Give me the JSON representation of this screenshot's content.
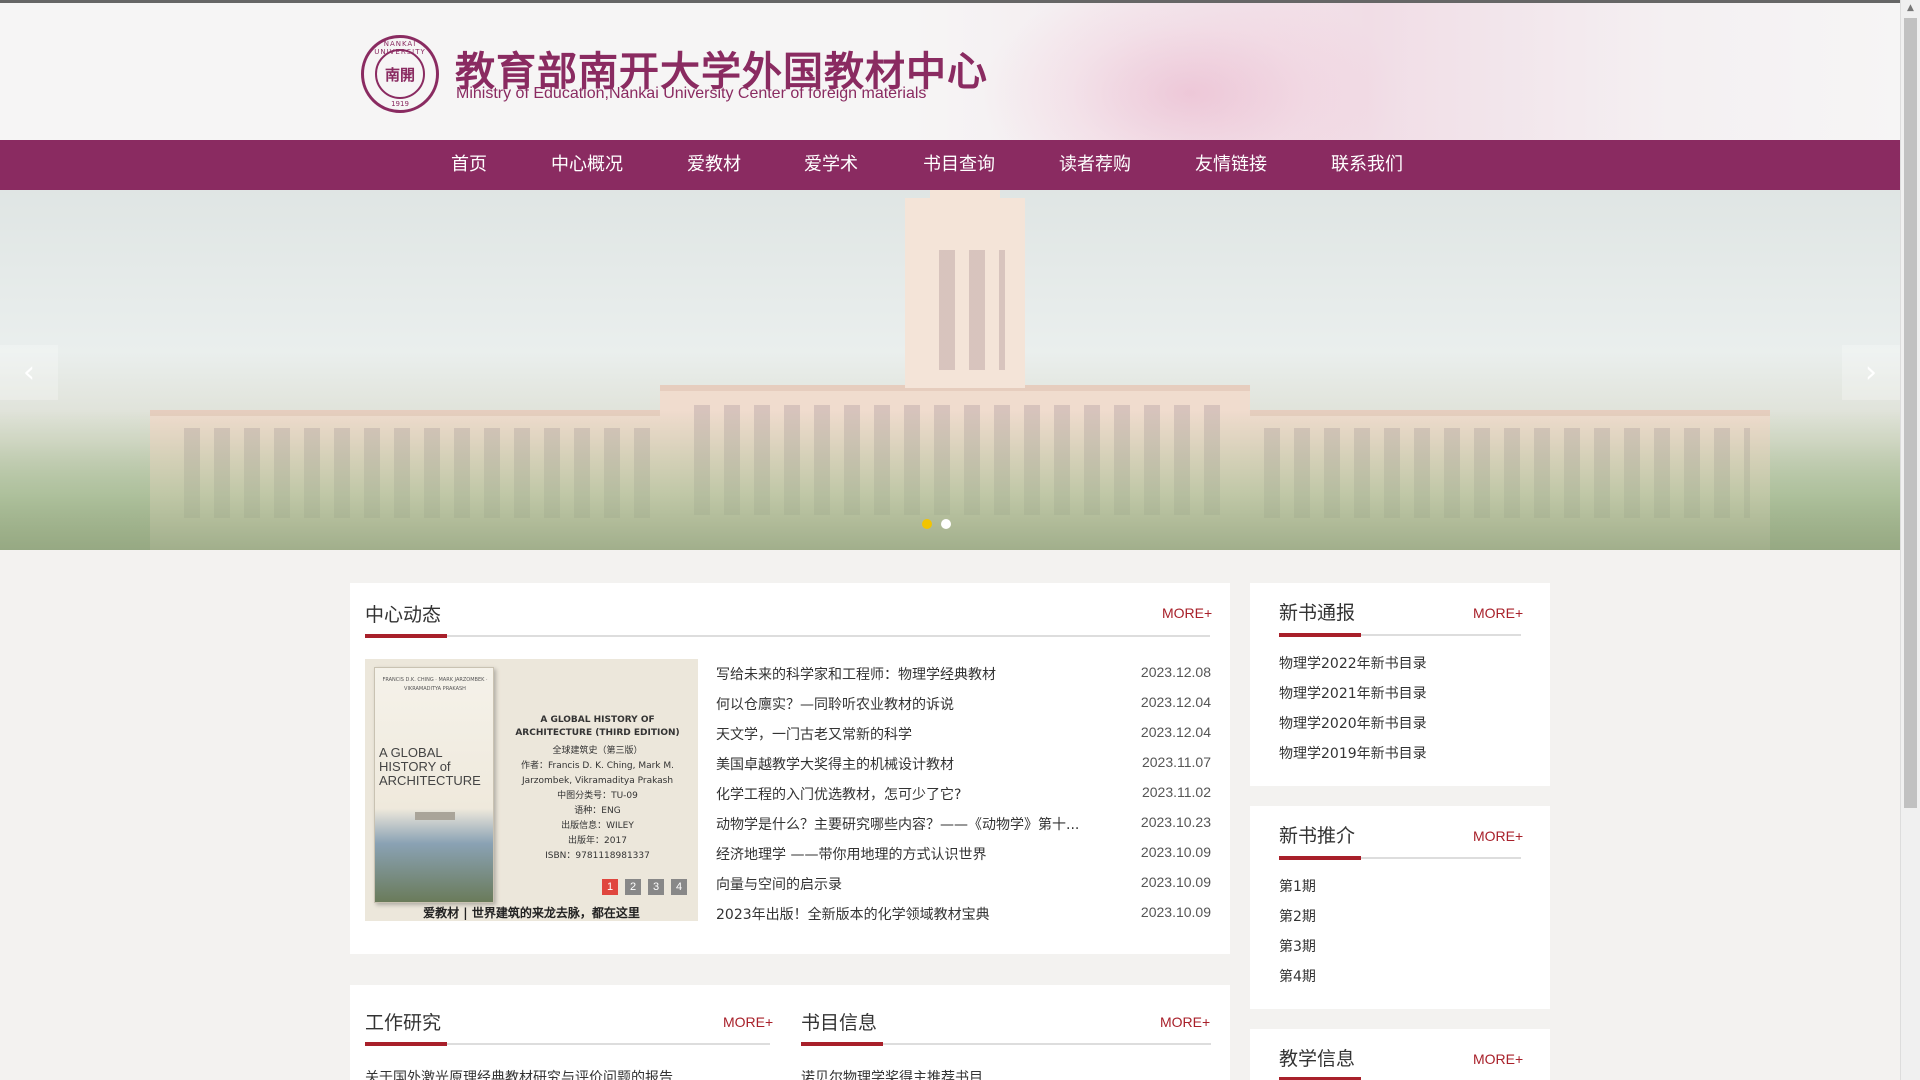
{
  "header": {
    "seal_center": "南開",
    "seal_top": "NANKAI UNIVERSITY",
    "seal_year": "1919",
    "title_cn": "教育部南开大学外国教材中心",
    "title_en": "Ministry of Education,Nankai University Center of foreign materials"
  },
  "nav": {
    "items": [
      {
        "label": "首页"
      },
      {
        "label": "中心概况"
      },
      {
        "label": "爱教材"
      },
      {
        "label": "爱学术"
      },
      {
        "label": "书目查询"
      },
      {
        "label": "读者荐购"
      },
      {
        "label": "友情链接"
      },
      {
        "label": "联系我们"
      }
    ]
  },
  "banner": {
    "prev_icon": "chevron-left-icon",
    "next_icon": "chevron-right-icon",
    "dots": [
      {
        "active": true,
        "color": "#f2c400"
      },
      {
        "active": false,
        "color": "#ffffff"
      }
    ]
  },
  "center_news": {
    "title": "中心动态",
    "more": "MORE+",
    "feature": {
      "cover_authors": "FRANCIS D.K. CHING · MARK JARZOMBEK · VIKRAMADITYA PRAKASH",
      "cover_title": "A GLOBAL HISTORY of ARCHITECTURE",
      "info_title": "A GLOBAL HISTORY OF ARCHITECTURE (THIRD EDITION)",
      "info_cn_title": "全球建筑史（第三版）",
      "info_author": "作者：Francis D. K. Ching, Mark M. Jarzombek, Vikramaditya Prakash",
      "info_class": "中图分类号：TU-09",
      "info_lang": "语种：ENG",
      "info_pub": "出版信息：WILEY",
      "info_year": "出版年：2017",
      "info_isbn": "ISBN：9781118981337",
      "pages": [
        "1",
        "2",
        "3",
        "4"
      ],
      "active_page": "1",
      "caption": "爱教材 | 世界建筑的来龙去脉，都在这里"
    },
    "items": [
      {
        "title": "写给未来的科学家和工程师：物理学经典教材",
        "date": "2023.12.08"
      },
      {
        "title": "何以仓廪实？—同聆听农业教材的诉说",
        "date": "2023.12.04"
      },
      {
        "title": "天文学，一门古老又常新的科学",
        "date": "2023.12.04"
      },
      {
        "title": "美国卓越教学大奖得主的机械设计教材",
        "date": "2023.11.07"
      },
      {
        "title": "化学工程的入门优选教材，怎可少了它?",
        "date": "2023.11.02"
      },
      {
        "title": "动物学是什么？主要研究哪些内容？——《动物学》第十...",
        "date": "2023.10.23"
      },
      {
        "title": "经济地理学 ——带你用地理的方式认识世界",
        "date": "2023.10.09"
      },
      {
        "title": "向量与空间的启示录",
        "date": "2023.10.09"
      },
      {
        "title": "2023年出版！全新版本的化学领域教材宝典",
        "date": "2023.10.09"
      }
    ]
  },
  "new_book_report": {
    "title": "新书通报",
    "more": "MORE+",
    "items": [
      "物理学2022年新书目录",
      "物理学2021年新书目录",
      "物理学2020年新书目录",
      "物理学2019年新书目录"
    ]
  },
  "new_book_recommend": {
    "title": "新书推介",
    "more": "MORE+",
    "items": [
      "第1期",
      "第2期",
      "第3期",
      "第4期"
    ]
  },
  "teaching_info": {
    "title": "教学信息",
    "more": "MORE+"
  },
  "work_research": {
    "title": "工作研究",
    "more": "MORE+",
    "first_item": "关于国外激光原理经典教材研究与评价问题的报告"
  },
  "catalog_info": {
    "title": "书目信息",
    "more": "MORE+",
    "first_item": "诺贝尔物理学奖得主推荐书目"
  },
  "colors": {
    "brand": "#8a2b61",
    "accent": "#a8202a",
    "background": "#f3f2f0"
  },
  "scrollbar": {
    "up_icon": "caret-up-icon"
  }
}
